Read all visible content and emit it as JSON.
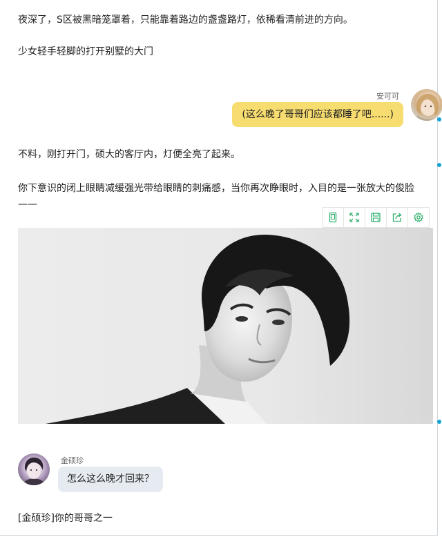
{
  "story": {
    "para1": "夜深了，S区被黑暗笼罩着，只能靠着路边的盏盏路灯，依稀看清前进的方向。",
    "para2": "少女轻手轻脚的打开别墅的大门",
    "para3": "不料，刚打开门，硕大的客厅内，灯便全亮了起来。",
    "para4": "你下意识的闭上眼睛减缓强光带给眼睛的刺痛感，当你再次睁眼时，入目的是一张放大的俊脸——",
    "para5": "[金硕珍]你的哥哥之一"
  },
  "chat_right": {
    "name": "安可可",
    "message": "(这么晚了哥哥们应该都睡了吧......)"
  },
  "chat_left": {
    "name": "金硕珍",
    "message": "怎么这么晚才回来？"
  },
  "image_toolbar": {
    "icons": [
      "page-icon",
      "expand-icon",
      "save-icon",
      "share-icon",
      "settings-icon"
    ],
    "color": "#2eaf6b"
  },
  "colors": {
    "right_bubble": "#f7dc6f",
    "left_bubble": "#e5ebf1"
  }
}
